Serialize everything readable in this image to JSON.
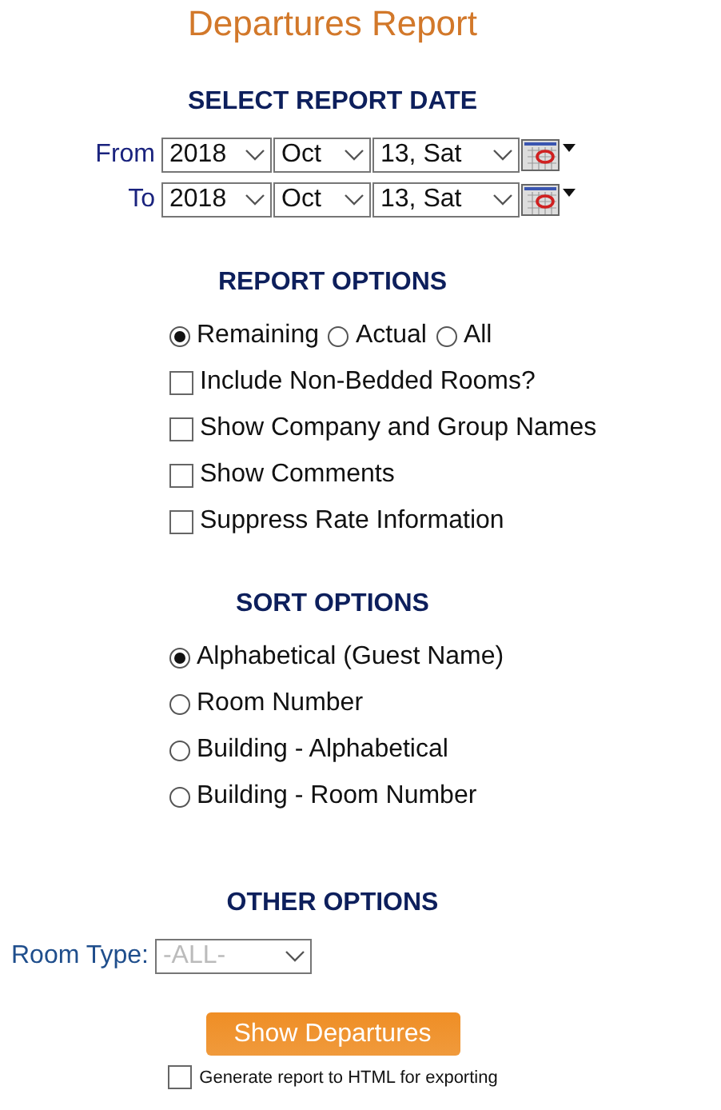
{
  "title": "Departures Report",
  "report_date": {
    "heading": "SELECT REPORT DATE",
    "rows": [
      {
        "label": "From",
        "year": "2018",
        "month": "Oct",
        "day": "13, Sat"
      },
      {
        "label": "To",
        "year": "2018",
        "month": "Oct",
        "day": "13, Sat"
      }
    ]
  },
  "report_options": {
    "heading": "REPORT OPTIONS",
    "types": [
      {
        "label": "Remaining",
        "selected": true
      },
      {
        "label": "Actual",
        "selected": false
      },
      {
        "label": "All",
        "selected": false
      }
    ],
    "checkboxes": [
      {
        "label": "Include Non-Bedded Rooms?",
        "checked": false
      },
      {
        "label": "Show Company and Group Names",
        "checked": false
      },
      {
        "label": "Show Comments",
        "checked": false
      },
      {
        "label": "Suppress Rate Information",
        "checked": false
      }
    ]
  },
  "sort_options": {
    "heading": "SORT OPTIONS",
    "items": [
      {
        "label": "Alphabetical (Guest Name)",
        "selected": true
      },
      {
        "label": "Room Number",
        "selected": false
      },
      {
        "label": "Building - Alphabetical",
        "selected": false
      },
      {
        "label": "Building - Room Number",
        "selected": false
      }
    ]
  },
  "other_options": {
    "heading": "OTHER OPTIONS",
    "room_type": {
      "label": "Room Type:",
      "value": "-ALL-",
      "disabled": true
    }
  },
  "submit_button": "Show Departures",
  "export_option": {
    "label": "Generate report to HTML for exporting",
    "checked": false
  }
}
